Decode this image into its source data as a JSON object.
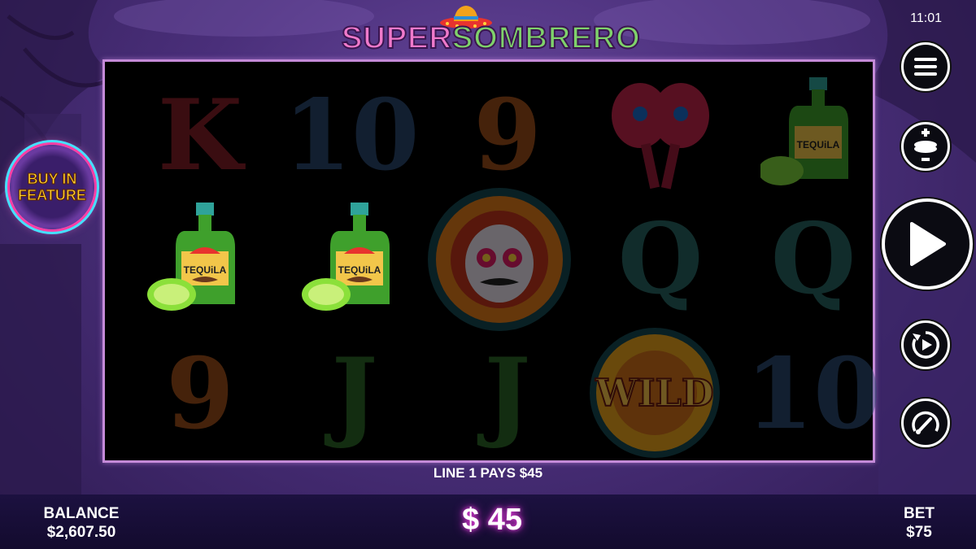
{
  "header": {
    "title_part1": "SUPER",
    "title_part2": "SOMBRERO",
    "clock": "11:01"
  },
  "buy_feature": {
    "line1": "BUY IN",
    "line2": "FEATURE"
  },
  "reels": {
    "rows": [
      [
        "K",
        "10",
        "9",
        "maracas",
        "tequila"
      ],
      [
        "tequila",
        "tequila",
        "sugar-skull",
        "Q",
        "Q"
      ],
      [
        "9",
        "J",
        "J",
        "wild",
        "10"
      ]
    ],
    "tequila_label": "TEQUiLA",
    "wild_label": "WILD"
  },
  "win_line_text": "LINE 1 PAYS $45",
  "footer": {
    "balance_label": "BALANCE",
    "balance_value": "$2,607.50",
    "win_amount": "$ 45",
    "bet_label": "BET",
    "bet_value": "$75"
  },
  "side_controls": [
    "menu-icon",
    "bet-adjust-icon",
    "play-icon",
    "autoplay-icon",
    "turbo-icon"
  ],
  "colors": {
    "reel_border": "#c48ad8",
    "win_glow": "#e03bd6",
    "buy_text": "#ffcf2e"
  }
}
